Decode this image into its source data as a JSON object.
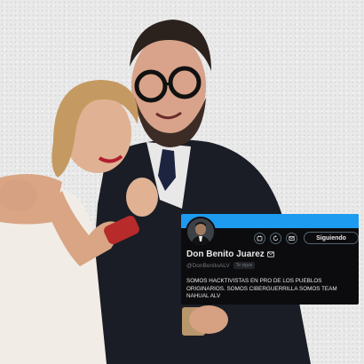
{
  "profile": {
    "name": "Don Benito Juarez",
    "handle": "@DonBenitoALV",
    "follows_you": "Te sigue",
    "follow_label": "Siguiendo",
    "bio": "SOMOS HACKTIVISTAS EN PRO DE LOS PUEBLOS ORIGINARIOS. SOMOS CIBERGUERRILLA SOMOS TEAM NAHUAL ALV"
  },
  "icons": [
    "more-icon",
    "bot-icon",
    "refresh-icon",
    "message-icon"
  ],
  "colors": {
    "banner": "#1d9bf0",
    "card_bg": "#0c0c0e",
    "text": "#e7e9ea",
    "muted": "#71767b"
  }
}
